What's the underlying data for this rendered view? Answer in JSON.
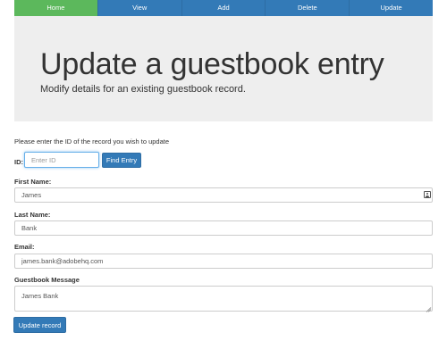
{
  "nav": {
    "items": [
      {
        "label": "Home",
        "active": true
      },
      {
        "label": "View",
        "active": false
      },
      {
        "label": "Add",
        "active": false
      },
      {
        "label": "Delete",
        "active": false
      },
      {
        "label": "Update",
        "active": false
      }
    ],
    "active_color": "#5cb85c",
    "primary_color": "#337ab7"
  },
  "header": {
    "title": "Update a guestbook entry",
    "subtitle": "Modify details for an existing guestbook record."
  },
  "form": {
    "intro": "Please enter the ID of the record you wish to update",
    "id": {
      "label": "ID:",
      "placeholder": "Enter ID",
      "value": ""
    },
    "find_button": "Find Entry",
    "first_name": {
      "label": "First Name:",
      "value": "James",
      "icon": "contact-card-icon"
    },
    "last_name": {
      "label": "Last Name:",
      "value": "Bank"
    },
    "email": {
      "label": "Email:",
      "value": "james.bank@adobehq.com"
    },
    "message": {
      "label": "Guestbook Message",
      "value": "James Bank"
    },
    "submit_button": "Update record"
  }
}
